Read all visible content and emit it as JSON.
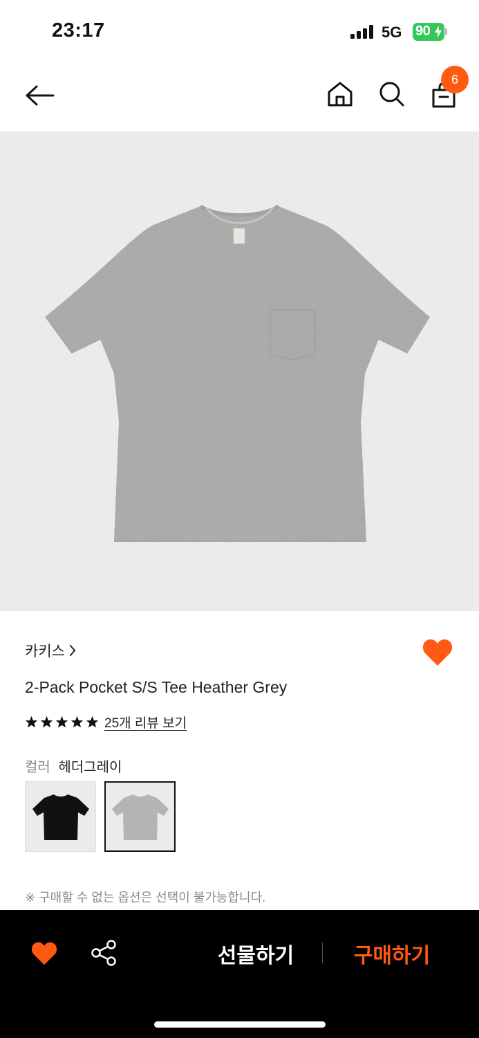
{
  "status_bar": {
    "time": "23:17",
    "network": "5G",
    "battery": "90"
  },
  "nav": {
    "cart_count": "6"
  },
  "product": {
    "brand": "카키스",
    "name": "2-Pack Pocket S/S Tee Heather Grey",
    "rating": 5,
    "review_link": "25개 리뷰 보기",
    "color_label": "컬러",
    "color_value": "헤더그레이",
    "swatches": [
      {
        "color": "black",
        "hex": "#111111",
        "selected": false
      },
      {
        "color": "heather-grey",
        "hex": "#b4b4b4",
        "selected": true
      }
    ],
    "notice": "※ 구매할 수 없는 옵션은 선택이 불가능합니다."
  },
  "bottom_bar": {
    "gift_label": "선물하기",
    "buy_label": "구매하기"
  },
  "colors": {
    "accent": "#ff5a12",
    "battery": "#34c759",
    "image_bg": "#ebebeb"
  },
  "icons": [
    "back-arrow-icon",
    "home-icon",
    "search-icon",
    "cart-bag-icon",
    "chevron-right-icon",
    "heart-icon",
    "star-icon",
    "share-icon"
  ]
}
